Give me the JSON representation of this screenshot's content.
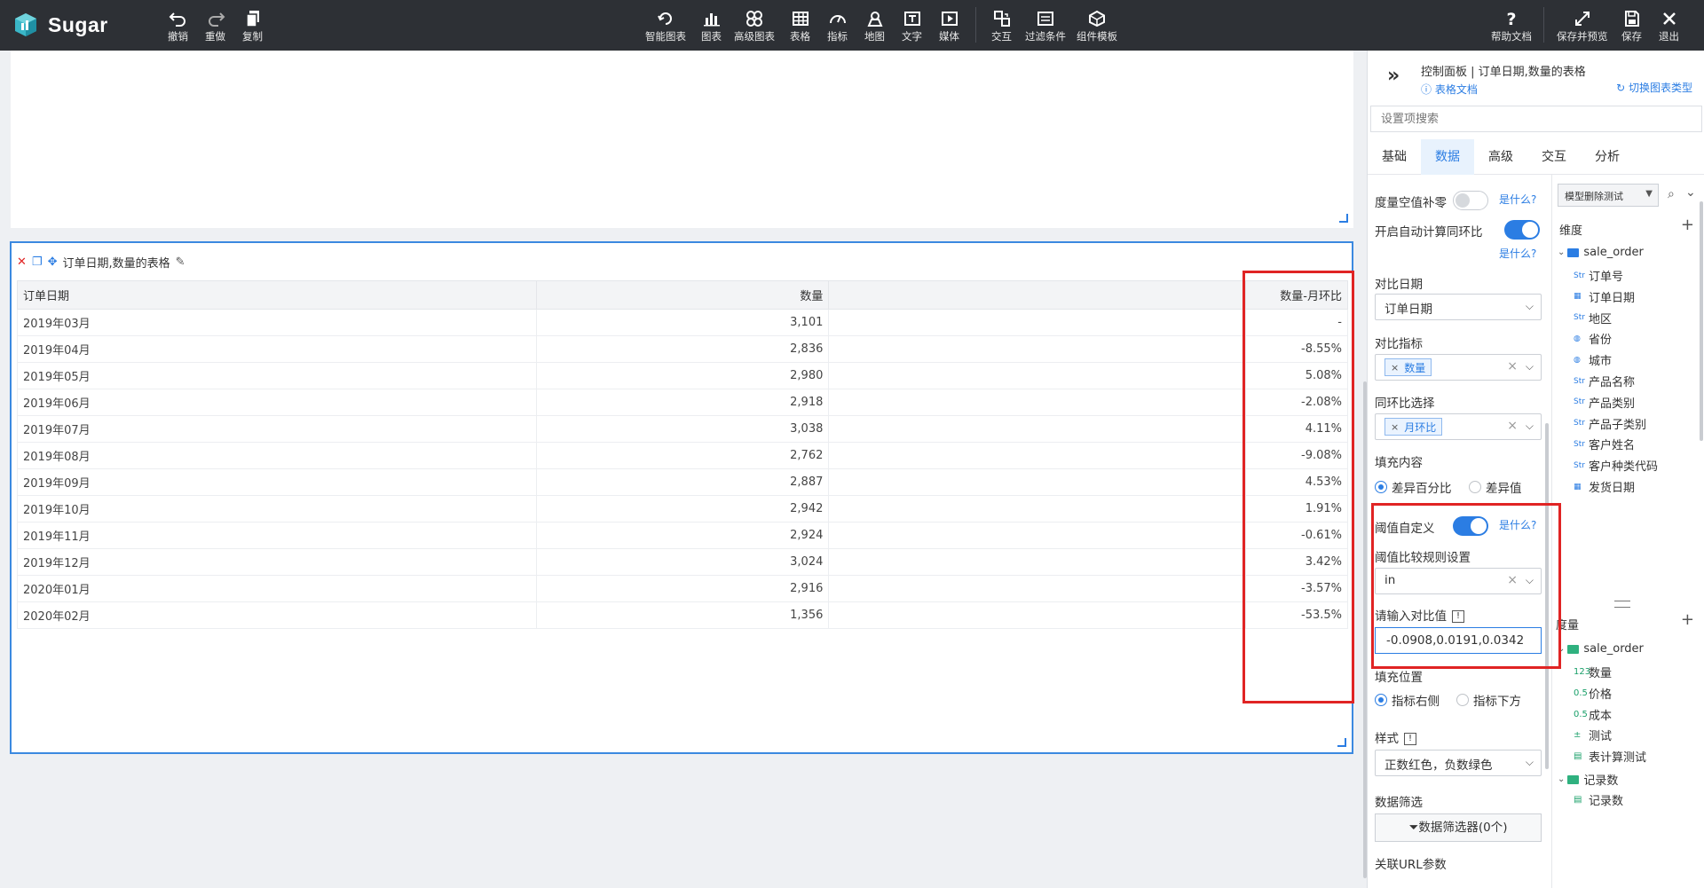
{
  "app": {
    "name": "Sugar"
  },
  "toolbar": {
    "left": [
      {
        "label": "撤销",
        "icon": "undo-icon"
      },
      {
        "label": "重做",
        "icon": "redo-icon"
      },
      {
        "label": "复制",
        "icon": "copy-icon"
      }
    ],
    "center": [
      {
        "label": "智能图表",
        "icon": "smart-chart-icon"
      },
      {
        "label": "图表",
        "icon": "bar-chart-icon"
      },
      {
        "label": "高级图表",
        "icon": "advanced-chart-icon"
      },
      {
        "label": "表格",
        "icon": "table-icon"
      },
      {
        "label": "指标",
        "icon": "gauge-icon"
      },
      {
        "label": "地图",
        "icon": "map-icon"
      },
      {
        "label": "文字",
        "icon": "text-icon"
      },
      {
        "label": "媒体",
        "icon": "media-icon"
      },
      {
        "label": "交互",
        "icon": "interaction-icon"
      },
      {
        "label": "过滤条件",
        "icon": "filter-condition-icon"
      },
      {
        "label": "组件模板",
        "icon": "component-template-icon"
      }
    ],
    "right": [
      {
        "label": "帮助文档",
        "icon": "help-icon"
      },
      {
        "label": "保存并预览",
        "icon": "expand-icon"
      },
      {
        "label": "保存",
        "icon": "save-icon"
      },
      {
        "label": "退出",
        "icon": "close-icon"
      }
    ]
  },
  "widget": {
    "title": "订单日期,数量的表格",
    "columns": [
      "订单日期",
      "数量",
      "",
      "数量-月环比"
    ],
    "rows": [
      {
        "date": "2019年03月",
        "qty": "3,101",
        "mom": "-",
        "sign": ""
      },
      {
        "date": "2019年04月",
        "qty": "2,836",
        "mom": "-8.55%",
        "sign": "neg"
      },
      {
        "date": "2019年05月",
        "qty": "2,980",
        "mom": "5.08%",
        "sign": "neg"
      },
      {
        "date": "2019年06月",
        "qty": "2,918",
        "mom": "-2.08%",
        "sign": "neg"
      },
      {
        "date": "2019年07月",
        "qty": "3,038",
        "mom": "4.11%",
        "sign": "neg"
      },
      {
        "date": "2019年08月",
        "qty": "2,762",
        "mom": "-9.08%",
        "sign": "pos"
      },
      {
        "date": "2019年09月",
        "qty": "2,887",
        "mom": "4.53%",
        "sign": "neg"
      },
      {
        "date": "2019年10月",
        "qty": "2,942",
        "mom": "1.91%",
        "sign": "pos"
      },
      {
        "date": "2019年11月",
        "qty": "2,924",
        "mom": "-0.61%",
        "sign": "neg"
      },
      {
        "date": "2019年12月",
        "qty": "3,024",
        "mom": "3.42%",
        "sign": "pos"
      },
      {
        "date": "2020年01月",
        "qty": "2,916",
        "mom": "-3.57%",
        "sign": "neg"
      },
      {
        "date": "2020年02月",
        "qty": "1,356",
        "mom": "-53.5%",
        "sign": "neg"
      }
    ]
  },
  "panel": {
    "title": "控制面板 | 订单日期,数量的表格",
    "doc_link": "表格文档",
    "switch_link": "切换图表类型",
    "search_placeholder": "设置项搜索",
    "tabs": [
      "基础",
      "数据",
      "高级",
      "交互",
      "分析"
    ],
    "active_tab": "数据",
    "what_link": "是什么?",
    "settings": {
      "null_fill_label": "度量空值补零",
      "auto_yoy_label": "开启自动计算同环比",
      "compare_date_label": "对比日期",
      "compare_date_value": "订单日期",
      "compare_metric_label": "对比指标",
      "compare_metric_tag": "数量",
      "yoy_select_label": "同环比选择",
      "yoy_select_tag": "月环比",
      "fill_content_label": "填充内容",
      "fill_content_opt1": "差异百分比",
      "fill_content_opt2": "差异值",
      "threshold_custom_label": "阈值自定义",
      "threshold_rule_label": "阈值比较规则设置",
      "threshold_rule_value": "in",
      "compare_value_label": "请输入对比值",
      "compare_value": "-0.0908,0.0191,0.0342",
      "fill_position_label": "填充位置",
      "fill_position_opt1": "指标右侧",
      "fill_position_opt2": "指标下方",
      "style_label": "样式",
      "style_value": "正数红色，负数绿色",
      "data_filter_label": "数据筛选",
      "data_filter_button": "数据筛选器(0个)",
      "url_param_label": "关联URL参数"
    },
    "fields": {
      "datasource": "模型删除测试",
      "dimension_label": "维度",
      "dimension_folder": "sale_order",
      "dimensions": [
        {
          "type": "Str",
          "name": "订单号"
        },
        {
          "type": "date",
          "name": "订单日期"
        },
        {
          "type": "Str",
          "name": "地区"
        },
        {
          "type": "geo",
          "name": "省份"
        },
        {
          "type": "geo",
          "name": "城市"
        },
        {
          "type": "Str",
          "name": "产品名称"
        },
        {
          "type": "Str",
          "name": "产品类别"
        },
        {
          "type": "Str",
          "name": "产品子类别"
        },
        {
          "type": "Str",
          "name": "客户姓名"
        },
        {
          "type": "Str",
          "name": "客户种类代码"
        },
        {
          "type": "date",
          "name": "发货日期"
        }
      ],
      "measure_label": "度量",
      "measure_folder": "sale_order",
      "measures": [
        {
          "type": "123",
          "name": "数量"
        },
        {
          "type": "0.5",
          "name": "价格"
        },
        {
          "type": "0.5",
          "name": "成本"
        },
        {
          "type": "calc",
          "name": "测试"
        },
        {
          "type": "tbl",
          "name": "表计算测试"
        }
      ],
      "record_folder": "记录数",
      "record_item": "记录数"
    }
  },
  "colors": {
    "accent": "#2b7de3",
    "toolbar_bg": "#2d3035",
    "highlight": "#e02424",
    "negative": "#2e9b2e",
    "positive": "#e8312f"
  }
}
